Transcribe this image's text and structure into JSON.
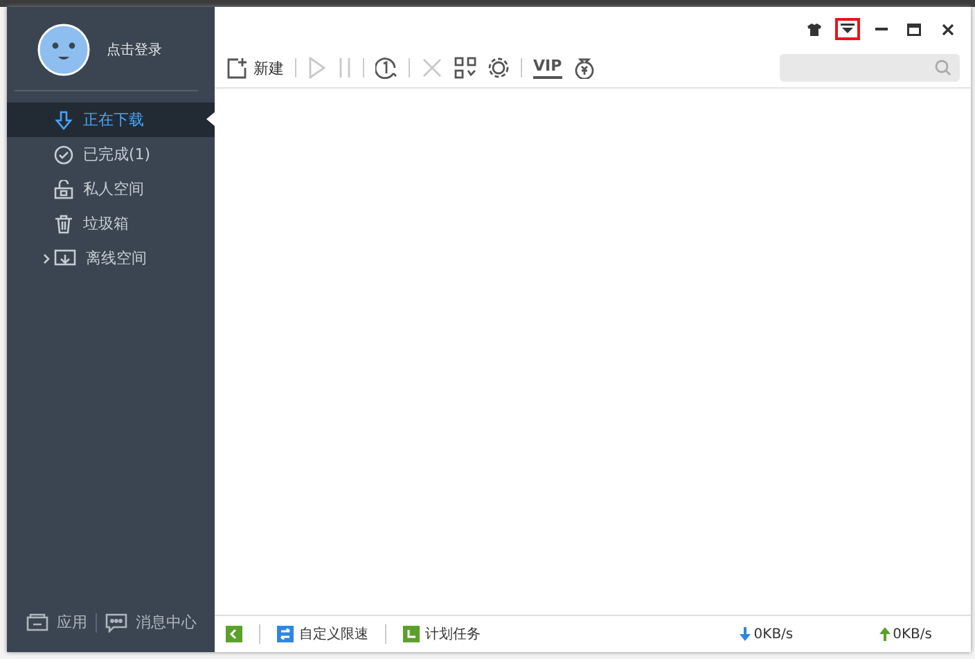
{
  "user": {
    "login_label": "点击登录"
  },
  "nav": [
    {
      "label": "正在下载",
      "kind": "download",
      "selected": true,
      "expandable": false
    },
    {
      "label": "已完成(1)",
      "kind": "check",
      "selected": false,
      "expandable": false
    },
    {
      "label": "私人空间",
      "kind": "lock",
      "selected": false,
      "expandable": false
    },
    {
      "label": "垃圾箱",
      "kind": "trash",
      "selected": false,
      "expandable": false
    },
    {
      "label": "离线空间",
      "kind": "cloud",
      "selected": false,
      "expandable": true
    }
  ],
  "sidebar_footer": [
    {
      "label": "应用",
      "kind": "apps"
    },
    {
      "label": "消息中心",
      "kind": "message"
    }
  ],
  "toolbar": [
    {
      "kind": "new",
      "label": "新建",
      "disabled": false
    },
    {
      "kind": "play",
      "disabled": true
    },
    {
      "kind": "pause",
      "disabled": true
    },
    {
      "kind": "one",
      "disabled": false
    },
    {
      "kind": "delete",
      "disabled": true
    },
    {
      "kind": "grid",
      "disabled": false
    },
    {
      "kind": "gear",
      "disabled": false
    },
    {
      "kind": "vip",
      "label": "VIP",
      "disabled": false
    },
    {
      "kind": "coin",
      "disabled": false
    }
  ],
  "window_controls": [
    {
      "kind": "skin",
      "highlighted": false
    },
    {
      "kind": "menu",
      "highlighted": true
    },
    {
      "kind": "minimize",
      "highlighted": false
    },
    {
      "kind": "maximize",
      "highlighted": false
    },
    {
      "kind": "close",
      "highlighted": false
    }
  ],
  "status_bar": {
    "items": [
      {
        "kind": "back"
      },
      {
        "kind": "speed",
        "label": "自定义限速"
      },
      {
        "kind": "schedule",
        "label": "计划任务"
      }
    ],
    "download_speed": "0KB/s",
    "upload_speed": "0KB/s"
  }
}
